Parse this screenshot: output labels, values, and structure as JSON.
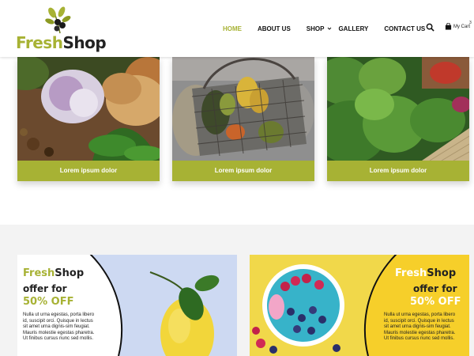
{
  "brand": {
    "fresh": "Fresh",
    "shop": "Shop"
  },
  "nav": {
    "items": [
      {
        "label": "HOME",
        "active": true
      },
      {
        "label": "ABOUT US"
      },
      {
        "label": "SHOP"
      },
      {
        "label": "GALLERY"
      },
      {
        "label": "CONTACT US"
      }
    ],
    "search_icon": "search-icon",
    "cart_label": "My Cart",
    "cart_count": "3"
  },
  "categories": [
    {
      "label": "Lorem ipsum dolor",
      "image": "garlic-potato-herbs"
    },
    {
      "label": "Lorem ipsum dolor",
      "image": "vegetable-basket"
    },
    {
      "label": "Lorem ipsum dolor",
      "image": "leafy-greens"
    }
  ],
  "offers": [
    {
      "brand_fresh": "Fresh",
      "brand_shop": "Shop",
      "offer_for": "offer for",
      "percent": "50% OFF",
      "body": "Nulla ut urna egestas, porta libero id, suscipit orci. Quisque in lectus sit amet urna dignis-sim feugiat. Mauris molestie egestas pharetra. Ut finibus cursus nunc sed mollis.",
      "image": "lemon"
    },
    {
      "brand_fresh": "Fresh",
      "brand_shop": "Shop",
      "offer_for": "offer for",
      "percent": "50% OFF",
      "body": "Nulla ut urna egestas, porta libero id, suscipit orci. Quisque in lectus sit amet urna dignis-sim feugiat. Mauris molestie egestas pharetra. Ut finibus cursus nunc sed mollis.",
      "image": "smoothie-bowl-berries"
    }
  ],
  "colors": {
    "accent": "#a7b234",
    "offer1_bg": "#cdd9f2",
    "offer2_bg": "#f1d84a",
    "section_bg": "#f3f3f3"
  }
}
